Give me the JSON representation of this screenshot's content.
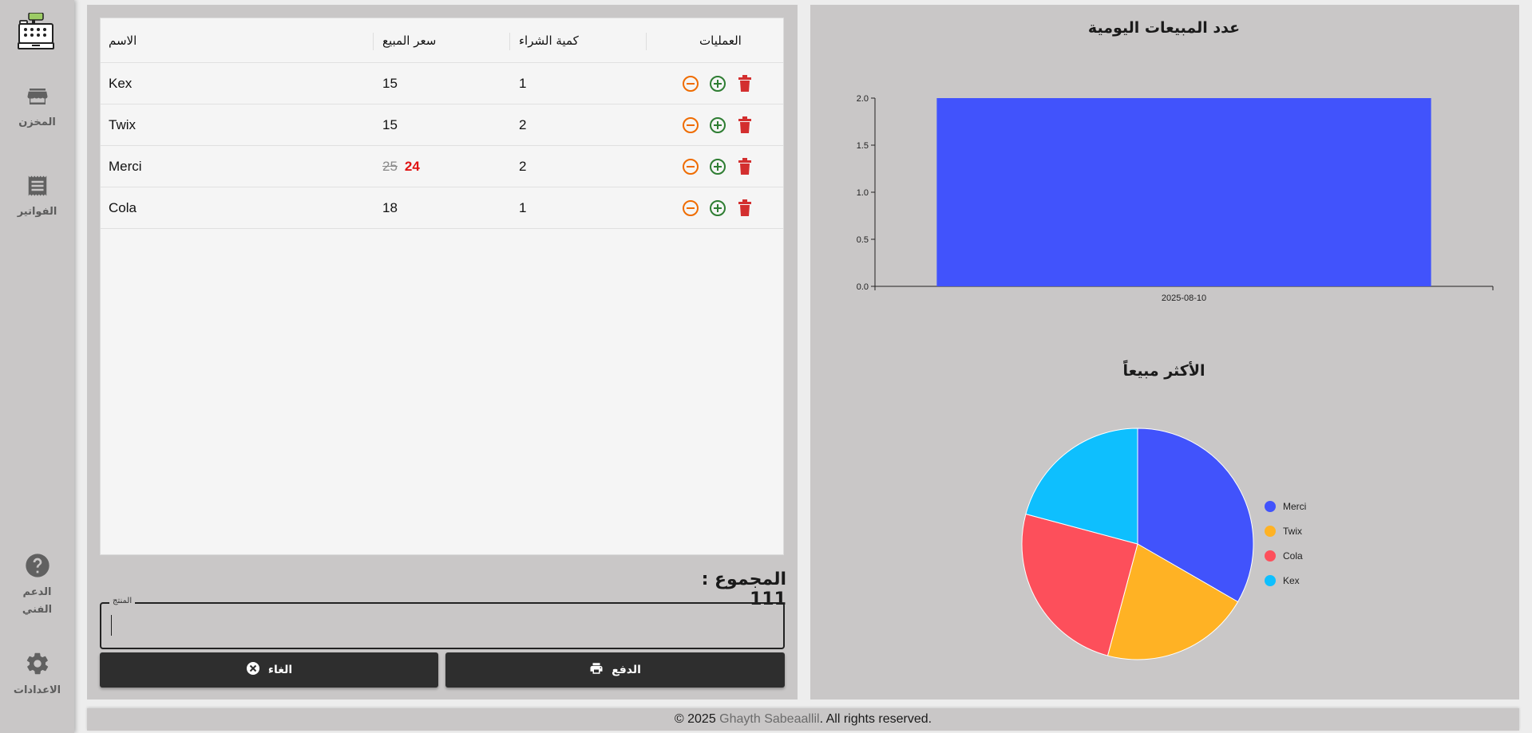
{
  "sidebar": {
    "logo_icon": "cash-register-icon",
    "items": [
      {
        "label": "المخزن",
        "icon": "store-icon"
      },
      {
        "label": "الفواتير",
        "icon": "receipt-icon"
      },
      {
        "label": "الدعم الفني",
        "icon": "help-icon"
      },
      {
        "label": "الاعدادات",
        "icon": "gear-icon"
      }
    ]
  },
  "table": {
    "headers": {
      "name": "الاسم",
      "price": "سعر المبيع",
      "qty": "كمية الشراء",
      "ops": "العمليات"
    },
    "rows": [
      {
        "name": "Kex",
        "price": "15",
        "qty": "1"
      },
      {
        "name": "Twix",
        "price": "15",
        "qty": "2"
      },
      {
        "name": "Merci",
        "old_price": "25",
        "new_price": "24",
        "qty": "2"
      },
      {
        "name": "Cola",
        "price": "18",
        "qty": "1"
      }
    ]
  },
  "total": {
    "label": "المجموع :",
    "value": "111"
  },
  "product_field": {
    "label": "المنتج",
    "value": ""
  },
  "buttons": {
    "cancel": "الغاء",
    "pay": "الدفع"
  },
  "colors": {
    "minus": "#ef6c00",
    "plus": "#2e7d32",
    "delete": "#d32f2f",
    "bar": "#4153fc",
    "panel": "#c9c7c7"
  },
  "chart_data": [
    {
      "type": "bar",
      "title": "عدد المبيعات اليومية",
      "categories": [
        "2025-08-10"
      ],
      "values": [
        2
      ],
      "ylim": [
        0,
        2
      ],
      "yticks": [
        "0.0",
        "0.5",
        "1.0",
        "1.5",
        "2.0"
      ],
      "color": "#4153fc"
    },
    {
      "type": "pie",
      "title": "الأكثر مبيعاً",
      "legend_position": "right",
      "labels": [
        "Merci",
        "Twix",
        "Cola",
        "Kex"
      ],
      "values": [
        24,
        15,
        18,
        15
      ],
      "colors": [
        "#4153fc",
        "#ffb224",
        "#fd4f5b",
        "#0ebffe"
      ]
    }
  ],
  "footer": {
    "prefix": "© 2025 ",
    "author": "Ghayth Sabeaallil",
    "suffix": ". All rights reserved."
  }
}
